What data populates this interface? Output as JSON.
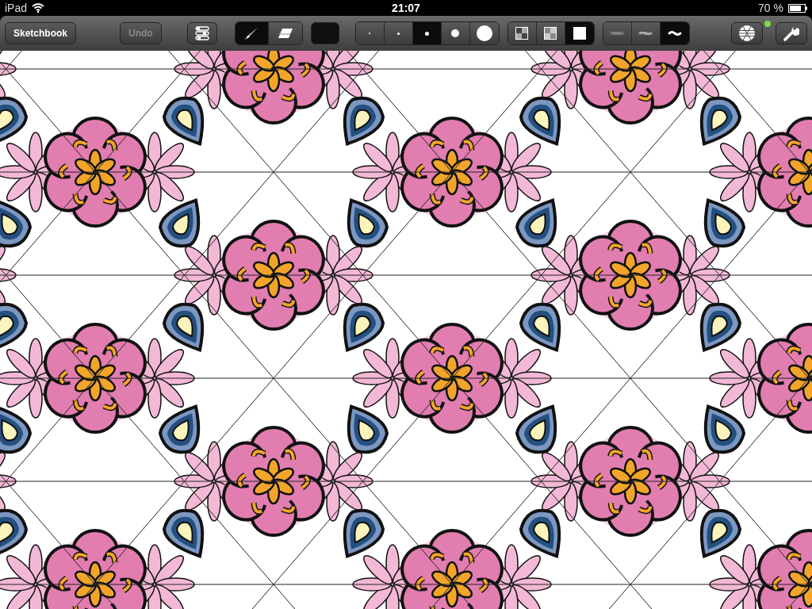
{
  "status_bar": {
    "device": "iPad",
    "time": "21:07",
    "battery": "70 %"
  },
  "toolbar": {
    "sketchbook_button": "Sketchbook",
    "undo_button": {
      "label": "Undo",
      "disabled": true
    },
    "tools": [
      {
        "kind": "brush",
        "selected": true
      },
      {
        "kind": "eraser",
        "selected": false
      }
    ],
    "brush_sizes": [
      {
        "selected": false
      },
      {
        "selected": false
      },
      {
        "selected": true
      },
      {
        "selected": false
      },
      {
        "selected": false
      }
    ],
    "opacities": [
      {
        "selected": false
      },
      {
        "selected": false
      },
      {
        "selected": true
      }
    ],
    "hardness": [
      {
        "selected": false
      },
      {
        "selected": false
      },
      {
        "selected": true
      }
    ],
    "symmetry_active": true
  }
}
